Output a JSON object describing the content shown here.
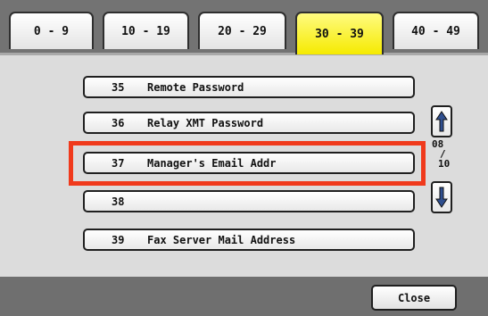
{
  "tabs": [
    "0 - 9",
    "10 - 19",
    "20 - 29",
    "30 - 39",
    "40 - 49"
  ],
  "active_tab": "30 - 39",
  "items": [
    {
      "num": "35",
      "label": "Remote Password"
    },
    {
      "num": "36",
      "label": "Relay XMT Password"
    },
    {
      "num": "37",
      "label": "Manager's Email Addr"
    },
    {
      "num": "38",
      "label": ""
    },
    {
      "num": "39",
      "label": "Fax Server Mail Address"
    }
  ],
  "selected_item": "37",
  "pager": {
    "current": "08",
    "separator": "/",
    "total": "10"
  },
  "footer": {
    "close_label": "Close"
  },
  "colors": {
    "active_tab": "#f5ea00",
    "highlight": "#f03a1c",
    "arrow_fill": "#2f4f8f"
  }
}
